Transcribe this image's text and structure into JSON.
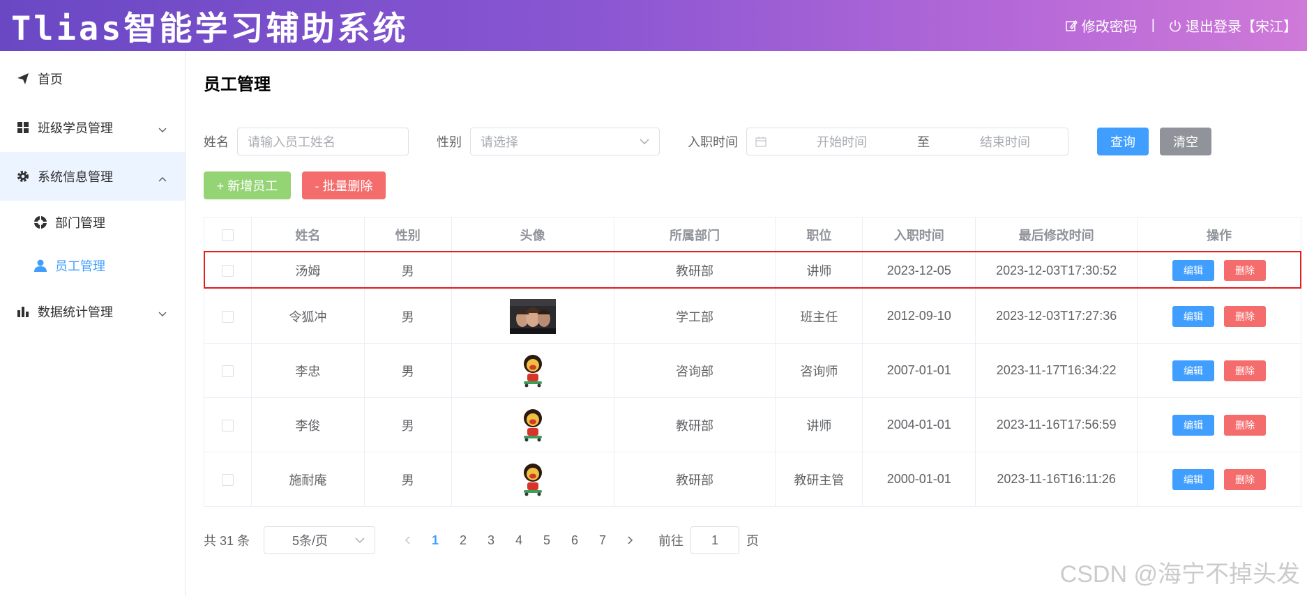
{
  "header": {
    "app_title": "Tlias智能学习辅助系统",
    "change_password": "修改密码",
    "separator": "|",
    "logout": "退出登录【宋江】"
  },
  "sidebar": {
    "items": [
      {
        "label": "首页",
        "icon": "paper-plane-icon"
      },
      {
        "label": "班级学员管理",
        "icon": "grid-icon"
      },
      {
        "label": "系统信息管理",
        "icon": "gear-icon",
        "open": true,
        "children": [
          {
            "label": "部门管理",
            "icon": "help-circle-icon"
          },
          {
            "label": "员工管理",
            "icon": "user-icon",
            "active": true
          }
        ]
      },
      {
        "label": "数据统计管理",
        "icon": "bar-chart-icon"
      }
    ]
  },
  "main": {
    "title": "员工管理",
    "search": {
      "name_label": "姓名",
      "name_placeholder": "请输入员工姓名",
      "gender_label": "性别",
      "gender_placeholder": "请选择",
      "date_label": "入职时间",
      "start_placeholder": "开始时间",
      "range_sep": "至",
      "end_placeholder": "结束时间",
      "query_btn": "查询",
      "clear_btn": "清空"
    },
    "actions": {
      "add_btn": "+ 新增员工",
      "batch_delete_btn": "- 批量删除"
    },
    "table": {
      "headers": [
        "姓名",
        "性别",
        "头像",
        "所属部门",
        "职位",
        "入职时间",
        "最后修改时间",
        "操作"
      ],
      "edit_label": "编辑",
      "delete_label": "删除",
      "rows": [
        {
          "name": "汤姆",
          "gender": "男",
          "avatar": "none",
          "dept": "教研部",
          "job": "讲师",
          "entry": "2023-12-05",
          "updated": "2023-12-03T17:30:52"
        },
        {
          "name": "令狐冲",
          "gender": "男",
          "avatar": "photo",
          "dept": "学工部",
          "job": "班主任",
          "entry": "2012-09-10",
          "updated": "2023-12-03T17:27:36"
        },
        {
          "name": "李忠",
          "gender": "男",
          "avatar": "cartoon",
          "dept": "咨询部",
          "job": "咨询师",
          "entry": "2007-01-01",
          "updated": "2023-11-17T16:34:22"
        },
        {
          "name": "李俊",
          "gender": "男",
          "avatar": "cartoon",
          "dept": "教研部",
          "job": "讲师",
          "entry": "2004-01-01",
          "updated": "2023-11-16T17:56:59"
        },
        {
          "name": "施耐庵",
          "gender": "男",
          "avatar": "cartoon",
          "dept": "教研部",
          "job": "教研主管",
          "entry": "2000-01-01",
          "updated": "2023-11-16T16:11:26"
        }
      ]
    },
    "pagination": {
      "total_text": "共 31 条",
      "page_size": "5条/页",
      "pages": [
        "1",
        "2",
        "3",
        "4",
        "5",
        "6",
        "7"
      ],
      "current_page": "1",
      "goto_label": "前往",
      "goto_value": "1",
      "page_suffix": "页"
    }
  },
  "watermark": "CSDN @海宁不掉头发",
  "colors": {
    "primary": "#409eff",
    "success": "#95d475",
    "danger": "#f56c6c",
    "info": "#909399",
    "highlight": "#e02020"
  }
}
